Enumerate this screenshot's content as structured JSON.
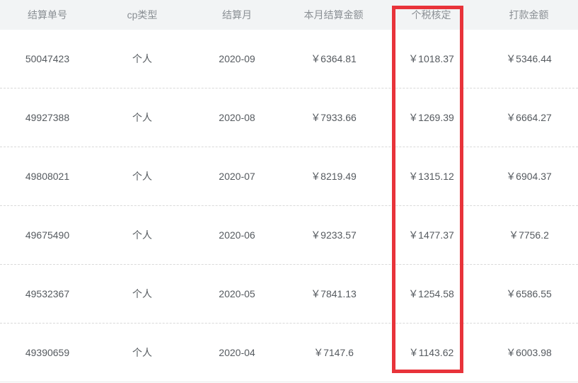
{
  "table": {
    "headers": [
      "结算单号",
      "cp类型",
      "结算月",
      "本月结算金额",
      "个税核定",
      "打款金额"
    ],
    "rows": [
      [
        "50047423",
        "个人",
        "2020-09",
        "￥6364.81",
        "￥1018.37",
        "￥5346.44"
      ],
      [
        "49927388",
        "个人",
        "2020-08",
        "￥7933.66",
        "￥1269.39",
        "￥6664.27"
      ],
      [
        "49808021",
        "个人",
        "2020-07",
        "￥8219.49",
        "￥1315.12",
        "￥6904.37"
      ],
      [
        "49675490",
        "个人",
        "2020-06",
        "￥9233.57",
        "￥1477.37",
        "￥7756.2"
      ],
      [
        "49532367",
        "个人",
        "2020-05",
        "￥7841.13",
        "￥1254.58",
        "￥6586.55"
      ],
      [
        "49390659",
        "个人",
        "2020-04",
        "￥7147.6",
        "￥1143.62",
        "￥6003.98"
      ]
    ]
  },
  "colors": {
    "header_bg": "#f2f4f5",
    "header_text": "#8a8f94",
    "cell_text": "#555a5f",
    "highlight": "#e8333a"
  }
}
